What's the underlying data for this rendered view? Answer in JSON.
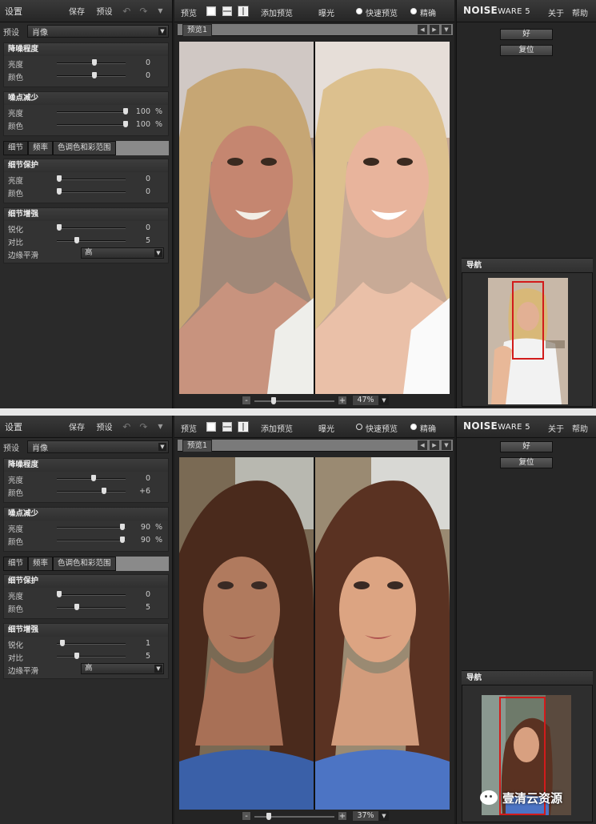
{
  "labels": {
    "settings": "设置",
    "save": "保存",
    "preset_btn": "预设",
    "preset_label": "预设",
    "noise_level": "降噪程度",
    "noise_reduction": "噪点减少",
    "brightness": "亮度",
    "color": "颜色",
    "detail_protect": "细节保护",
    "detail_enhance": "细节增强",
    "sharpen": "锐化",
    "contrast": "对比",
    "edge_smooth": "边缘平滑",
    "tabs": [
      "细节",
      "频率",
      "色调色和彩范围"
    ],
    "preview": "预览",
    "add_preview": "添加预览",
    "exposure": "曝光",
    "quick_preview": "快速预览",
    "precise": "精确",
    "preview_tab": "预览1",
    "logo_main": "NOISE",
    "logo_sub": "WARE 5",
    "about": "关于",
    "help": "帮助",
    "ok": "好",
    "reset": "复位",
    "navigator": "导航",
    "percent": "%",
    "zoom_minus": "-",
    "zoom_plus": "+"
  },
  "instances": [
    {
      "preset_value": "肖像",
      "noise_level": {
        "brightness": "0",
        "color": "0"
      },
      "noise_reduction": {
        "brightness": "100",
        "color": "100"
      },
      "detail_protect": {
        "brightness": "0",
        "color": "0"
      },
      "detail_enhance": {
        "sharpen": "0",
        "contrast": "5",
        "edge_smooth": "高"
      },
      "zoom": "47%"
    },
    {
      "preset_value": "肖像",
      "noise_level": {
        "brightness": "0",
        "color": "+6"
      },
      "noise_reduction": {
        "brightness": "90",
        "color": "90"
      },
      "detail_protect": {
        "brightness": "0",
        "color": "5"
      },
      "detail_enhance": {
        "sharpen": "1",
        "contrast": "5",
        "edge_smooth": "高"
      },
      "zoom": "37%"
    }
  ],
  "watermark": "壹清云资源"
}
